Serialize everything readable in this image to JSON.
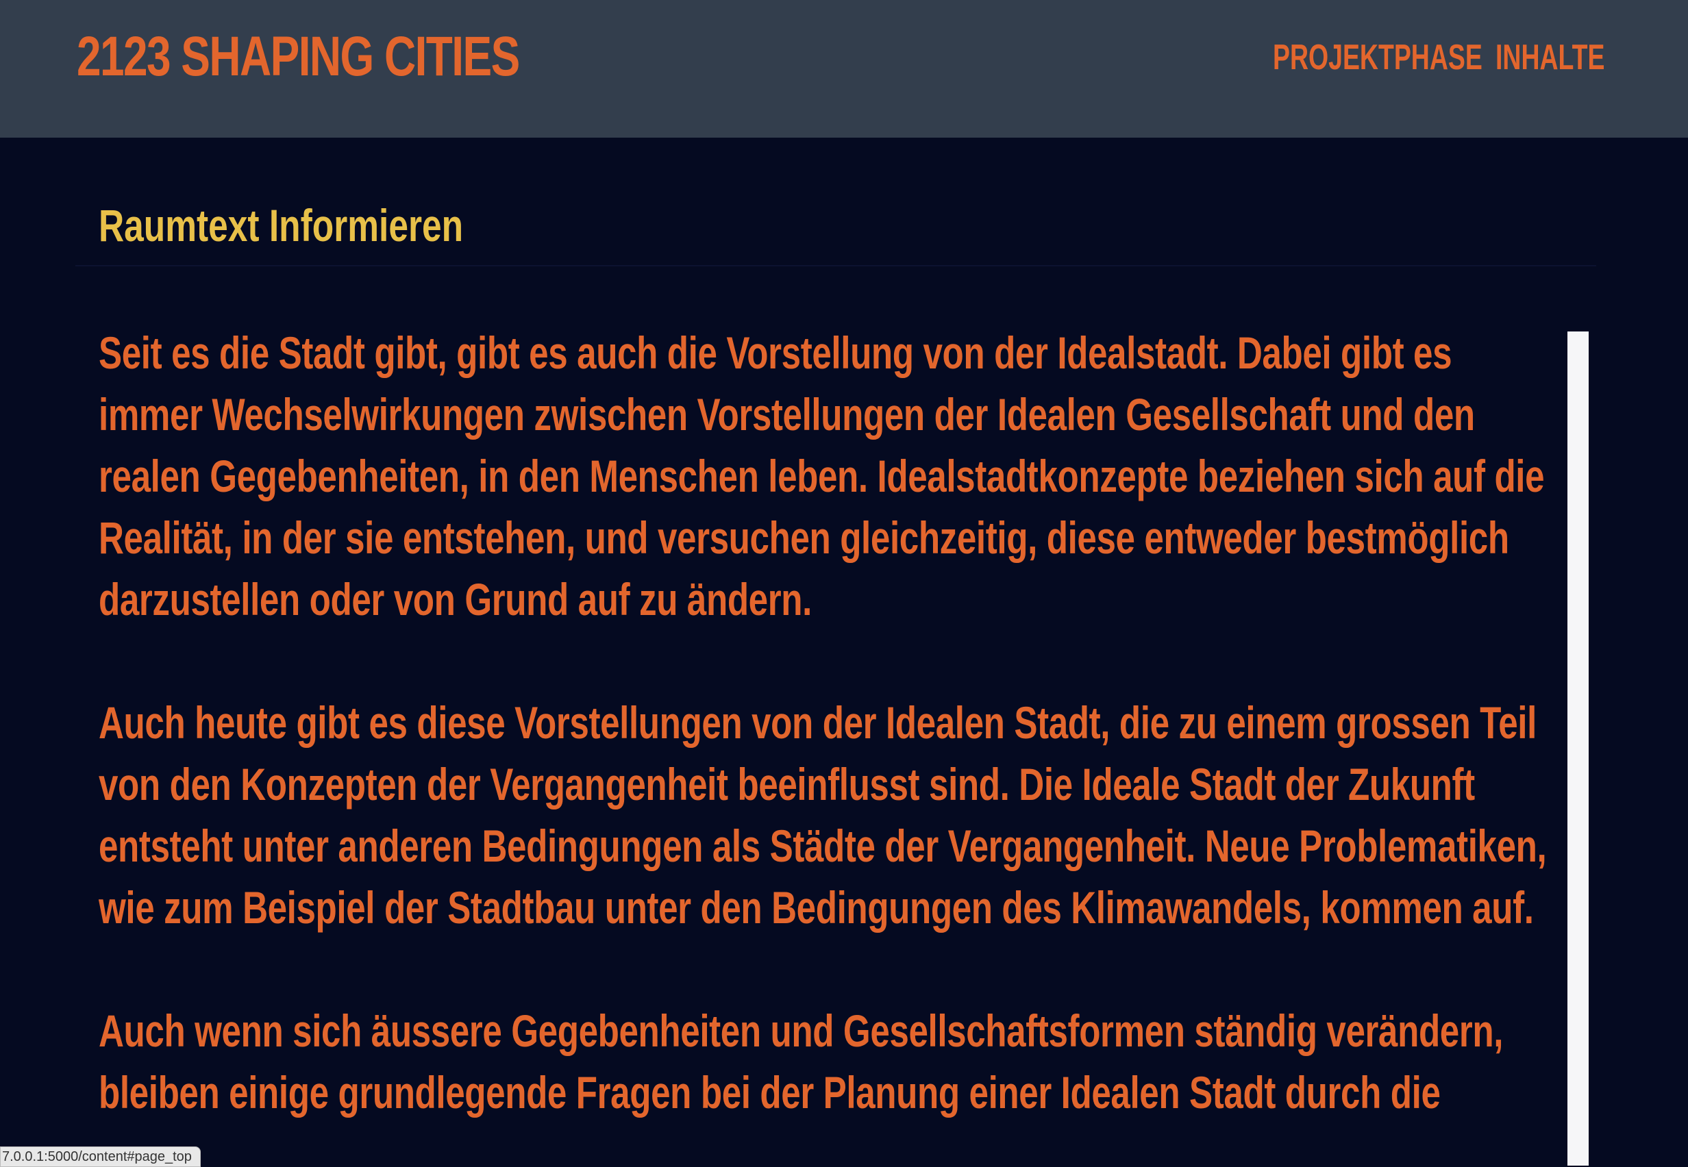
{
  "header": {
    "brand": "2123 SHAPING CITIES",
    "nav": [
      {
        "label": "PROJEKTPHASE"
      },
      {
        "label": "INHALTE"
      }
    ]
  },
  "main": {
    "title": "Raumtext Informieren",
    "paragraphs": [
      "Seit es die Stadt gibt, gibt es auch die Vorstellung von der Idealstadt. Dabei gibt es immer Wechselwirkungen zwischen Vorstellungen der Idealen Gesellschaft und den realen Gegebenheiten, in den Menschen leben. Idealstadtkonzepte beziehen sich auf die Realität, in der sie entstehen, und versuchen gleichzeitig, diese entweder bestmöglich darzustellen oder von Grund auf zu ändern.",
      "Auch heute gibt es diese Vorstellungen von der Idealen Stadt, die zu einem grossen Teil von den Konzepten der Vergangenheit beeinflusst sind. Die Ideale Stadt der Zukunft entsteht unter anderen Bedingungen als Städte der Vergangenheit. Neue Problematiken, wie zum Beispiel der Stadtbau unter den Bedingungen des Klimawandels, kommen auf.",
      "Auch wenn sich äussere Gegebenheiten und Gesellschaftsformen ständig verändern, bleiben einige grundlegende Fragen bei der Planung einer Idealen Stadt durch die"
    ]
  },
  "status_bar": {
    "url": "7.0.0.1:5000/content#page_top"
  },
  "colors": {
    "background": "#050a21",
    "header_bg": "#333e4d",
    "accent_orange": "#e3662d",
    "title_yellow": "#e8c049"
  }
}
